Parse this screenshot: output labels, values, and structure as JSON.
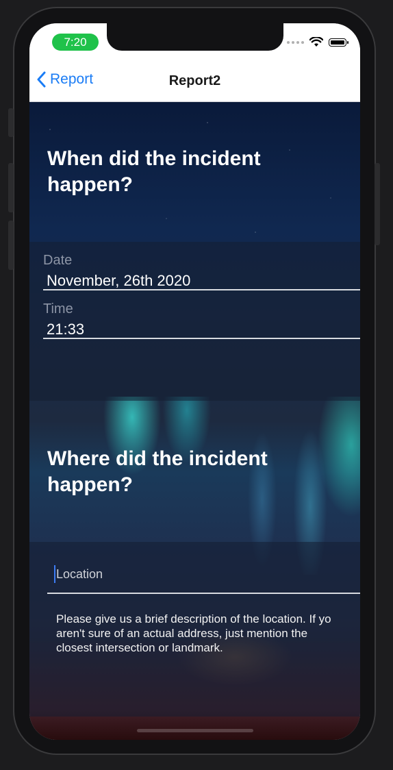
{
  "status_bar": {
    "time": "7:20"
  },
  "nav": {
    "back_label": "Report",
    "title": "Report2"
  },
  "section_when": {
    "heading": "When did the incident\nhappen?",
    "date_label": "Date",
    "date_value": "November, 26th 2020",
    "time_label": "Time",
    "time_value": "21:33"
  },
  "section_where": {
    "heading": "Where did the incident\nhappen?",
    "location_placeholder": "Location",
    "help_lines": [
      "Please give us a brief description of the location. If yo",
      "aren't sure of an actual address, just mention the",
      "closest intersection or landmark."
    ]
  },
  "colors": {
    "accent": "#1a7cf5",
    "time_pill": "#1fc24a",
    "heading_text": "#ffffff",
    "label_text": "#8d95a6"
  },
  "icons": {
    "back": "chevron-left-icon",
    "wifi": "wifi-icon",
    "battery": "battery-icon",
    "signal": "cellular-signal-icon"
  }
}
